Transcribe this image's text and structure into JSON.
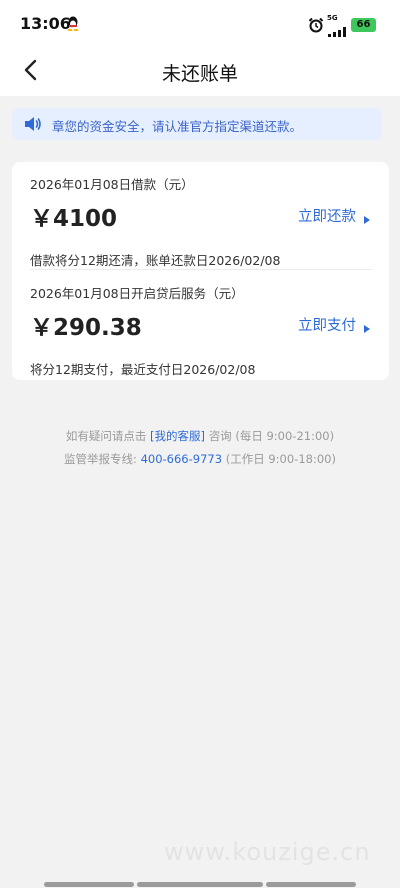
{
  "status": {
    "time": "13:06",
    "network": "5G",
    "battery": "66"
  },
  "header": {
    "title": "未还账单"
  },
  "notice": {
    "text": "章您的资金安全，请认准官方指定渠道还款。"
  },
  "bills": [
    {
      "date": "2026年01月08日借款（元）",
      "amount": "￥4100",
      "action": "立即还款",
      "note": "借款将分12期还清，账单还款日2026/02/08"
    },
    {
      "date": "2026年01月08日开启贷后服务（元）",
      "amount": "￥290.38",
      "action": "立即支付",
      "note": "将分12期支付，最近支付日2026/02/08"
    }
  ],
  "help": {
    "line1_prefix": "如有疑问请点击",
    "line1_link": "[我的客服]",
    "line1_suffix": "咨询 (每日 9:00-21:00)",
    "line2_prefix": "监管举报专线:",
    "line2_link": "400-666-9773",
    "line2_suffix": "(工作日 9:00-18:00)"
  },
  "watermark": "www.kouzige.cn",
  "colors": {
    "accent": "#2f6bd8",
    "notice_bg": "#e6efff",
    "battery": "#3ec85b"
  }
}
